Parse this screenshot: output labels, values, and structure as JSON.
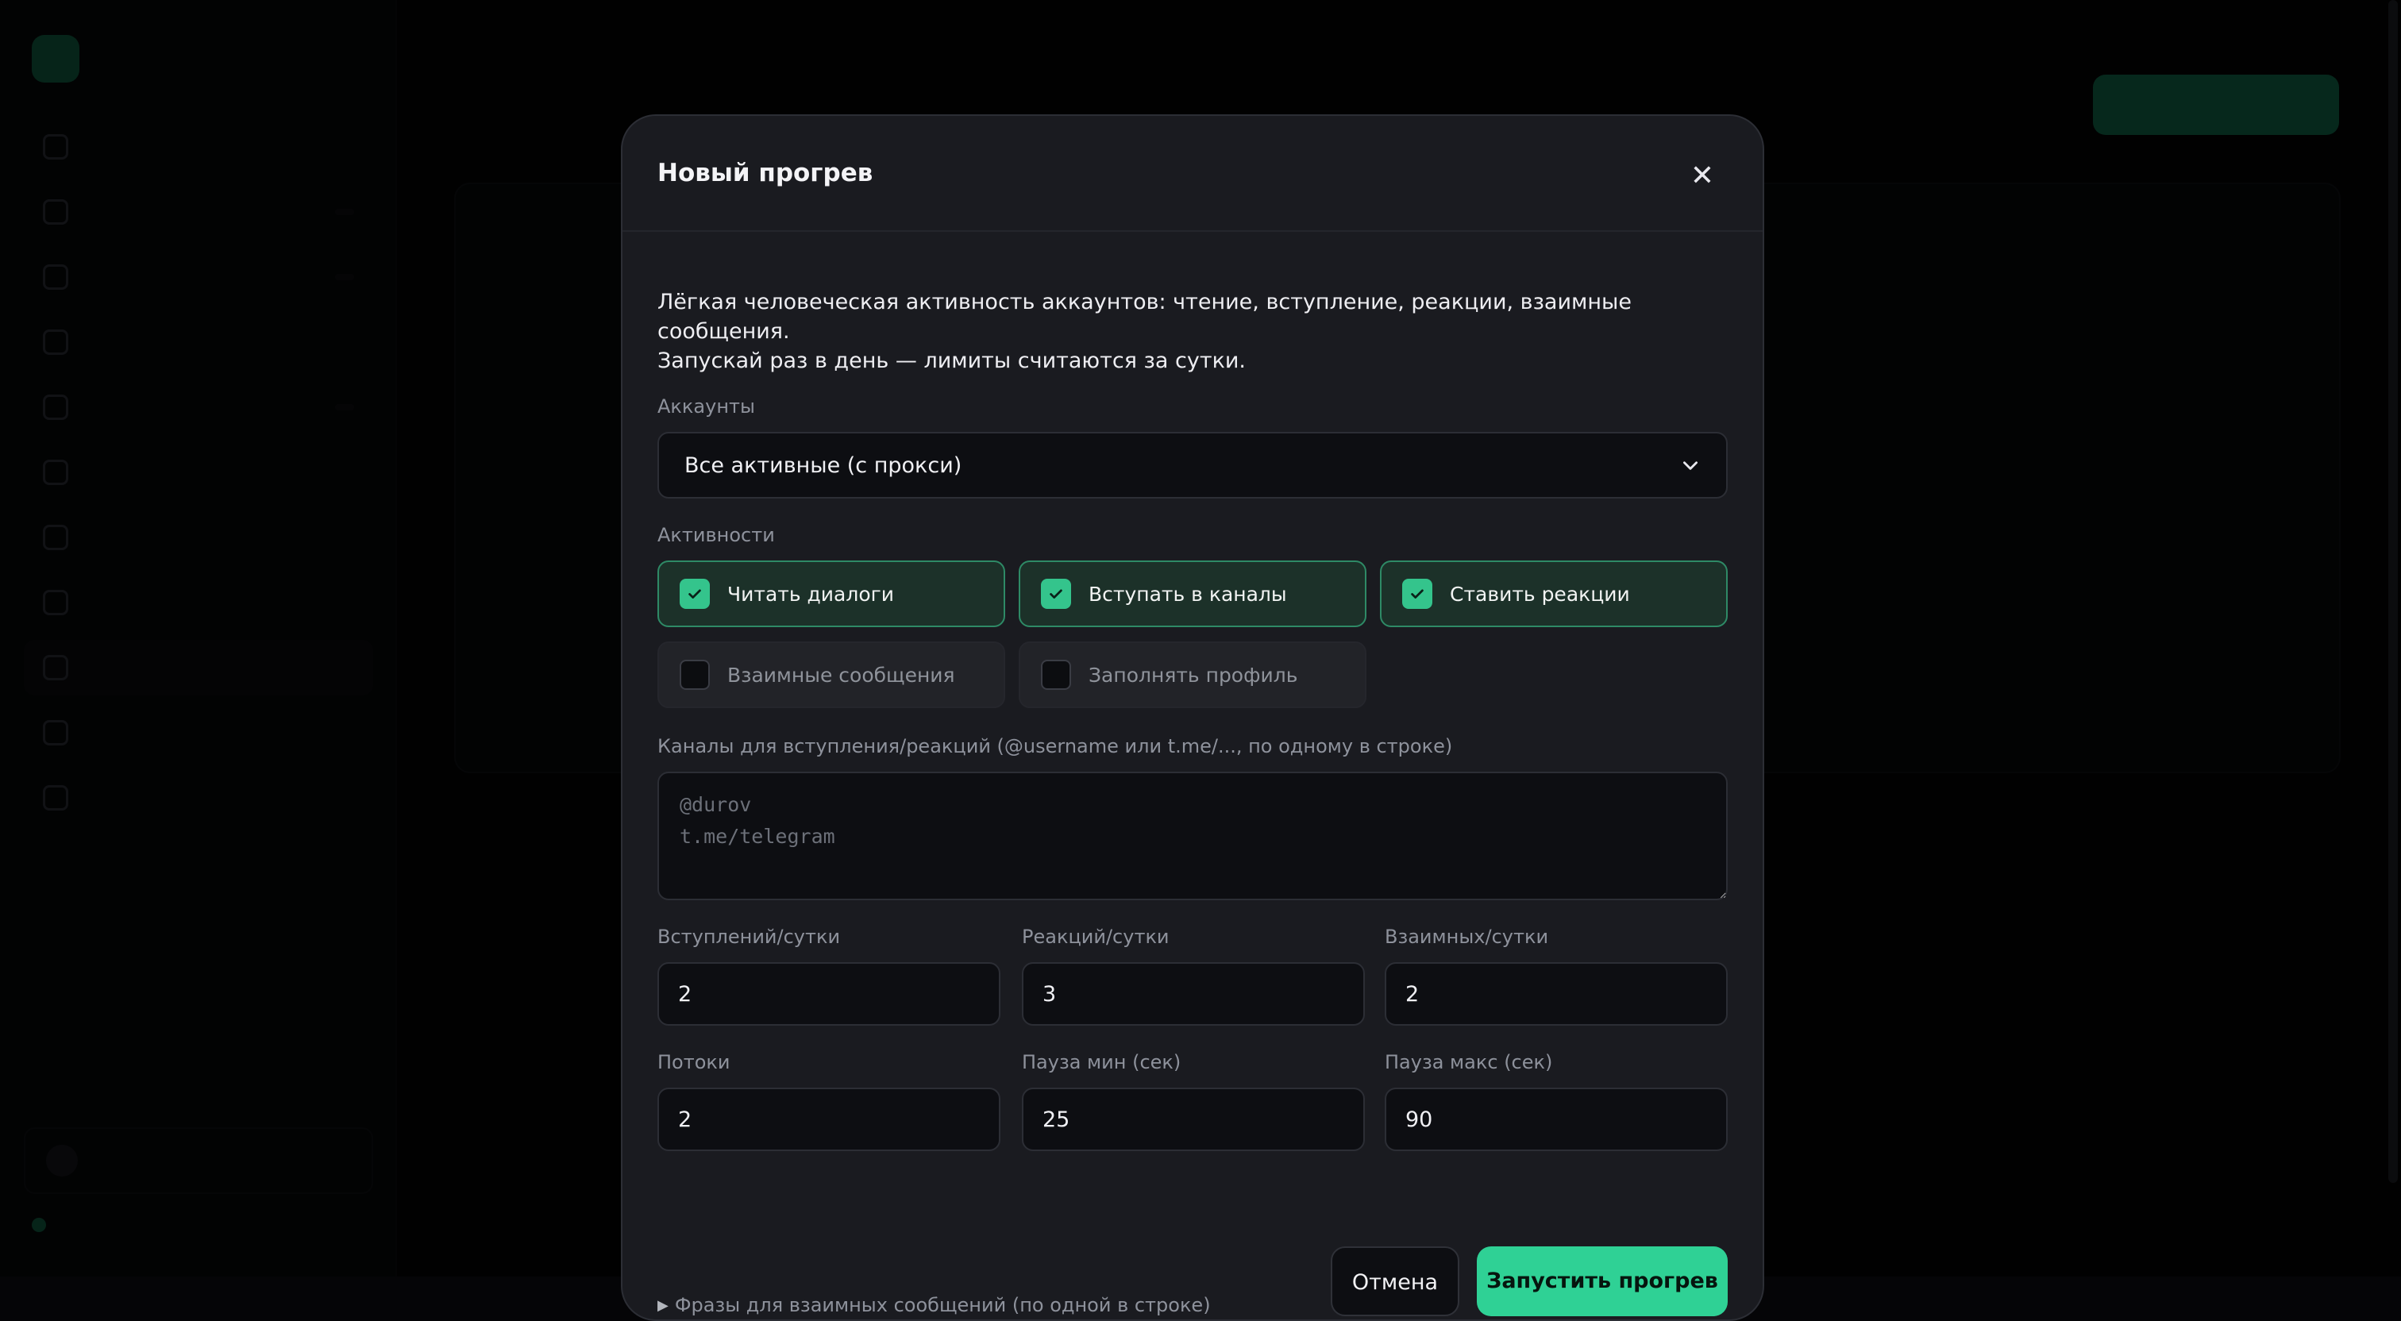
{
  "colors": {
    "accent": "#2fd195",
    "accent_checked_bg": "#1c3129",
    "accent_checked_border": "#2e8a66",
    "modal_bg": "#1a1b20",
    "input_bg": "#0d0e12",
    "page_bg": "#050507"
  },
  "modal": {
    "title": "Новый прогрев",
    "close_icon": "close-icon",
    "description_line1": "Лёгкая человеческая активность аккаунтов: чтение, вступление, реакции, взаимные сообщения.",
    "description_line2": "Запускай раз в день — лимиты считаются за сутки.",
    "accounts": {
      "label": "Аккаунты",
      "value": "Все активные (с прокси)",
      "icon": "chevron-down-icon"
    },
    "activities": {
      "label": "Активности",
      "items": [
        {
          "label": "Читать диалоги",
          "checked": true
        },
        {
          "label": "Вступать в каналы",
          "checked": true
        },
        {
          "label": "Ставить реакции",
          "checked": true
        },
        {
          "label": "Взаимные сообщения",
          "checked": false
        },
        {
          "label": "Заполнять профиль",
          "checked": false
        }
      ]
    },
    "channels": {
      "label": "Каналы для вступления/реакций (@username или t.me/..., по одному в строке)",
      "placeholder": "@durov\nt.me/telegram"
    },
    "limits": {
      "joins_label": "Вступлений/сутки",
      "joins_value": "2",
      "reactions_label": "Реакций/сутки",
      "reactions_value": "3",
      "mutual_label": "Взаимных/сутки",
      "mutual_value": "2",
      "threads_label": "Потоки",
      "threads_value": "2",
      "pause_min_label": "Пауза мин (сек)",
      "pause_min_value": "25",
      "pause_max_label": "Пауза макс (сек)",
      "pause_max_value": "90"
    },
    "phrases_toggle": "Фразы для взаимных сообщений (по одной в строке)",
    "cancel_label": "Отмена",
    "submit_label": "Запустить прогрев"
  }
}
